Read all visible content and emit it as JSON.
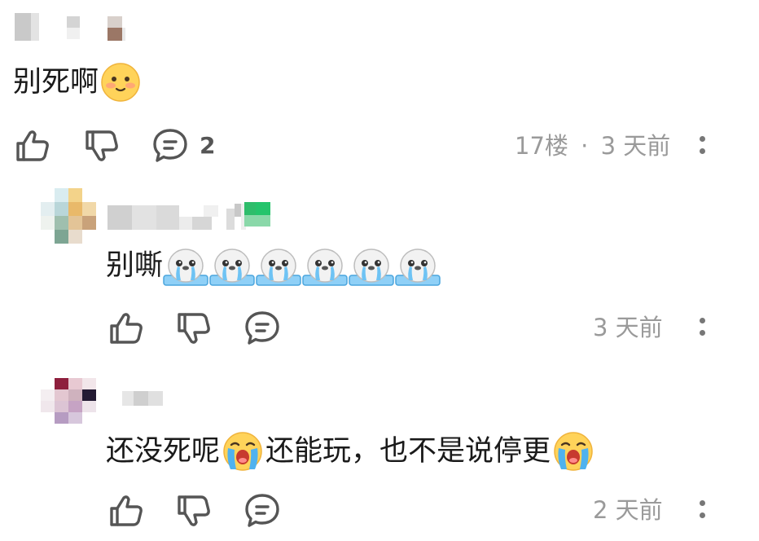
{
  "main_comment": {
    "text": "别死啊",
    "emoji": "smiling-face-emoji",
    "reply_count": "2",
    "floor": "17楼",
    "separator": "·",
    "time": "3 天前"
  },
  "replies": [
    {
      "text": "别嘶",
      "emoji": "crying-seal-emoji",
      "emoji_count": 6,
      "time": "3 天前"
    },
    {
      "text_1": "还没死呢",
      "emoji_1": "crying-face-emoji",
      "text_2": "还能玩，也不是说停更",
      "emoji_2": "crying-face-emoji",
      "time": "2 天前"
    }
  ],
  "icons": {
    "like": "thumbs-up-icon",
    "dislike": "thumbs-down-icon",
    "reply": "comment-bubble-icon",
    "more": "more-vertical-icon"
  },
  "colors": {
    "meta_text": "#9a9a9a",
    "icon_stroke": "#555555",
    "badge_green": "#2ebd6b"
  }
}
